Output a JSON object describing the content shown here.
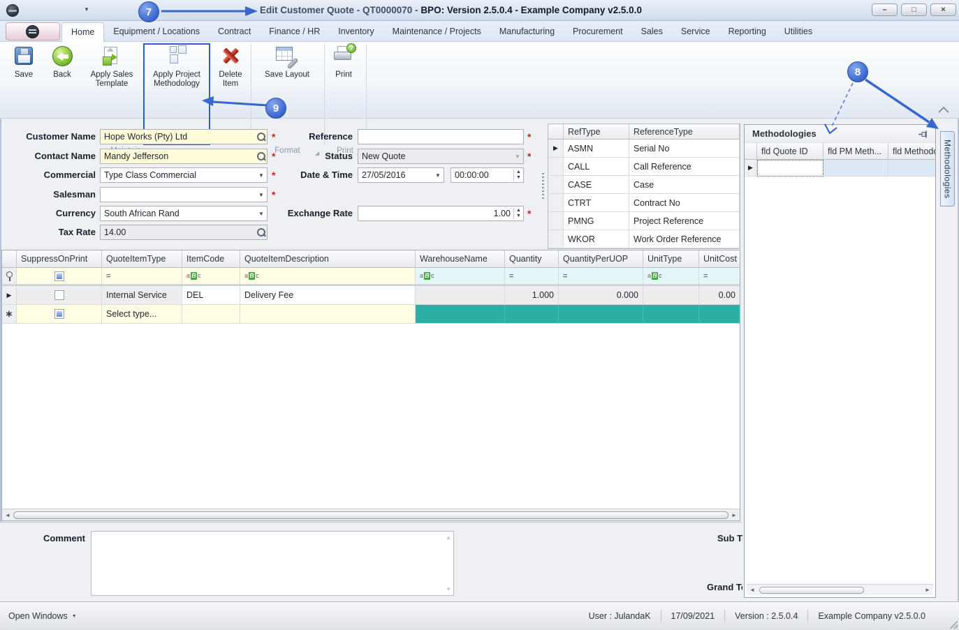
{
  "window": {
    "title_part1": "Edit Customer Quote - QT0000070 - ",
    "title_part2": "BPO: Version 2.5.0.4 - Example Company v2.5.0.0"
  },
  "tabs": [
    "Home",
    "Equipment / Locations",
    "Contract",
    "Finance / HR",
    "Inventory",
    "Maintenance / Projects",
    "Manufacturing",
    "Procurement",
    "Sales",
    "Service",
    "Reporting",
    "Utilities"
  ],
  "ribbon": {
    "buttons": {
      "save": "Save",
      "back": "Back",
      "apply_sales": "Apply Sales Template",
      "apply_pm": "Apply Project Methodology",
      "delete_item": "Delete Item",
      "save_layout": "Save Layout",
      "print": "Print"
    },
    "groups": {
      "maintain": "Maintain",
      "format": "Format",
      "print": "Print"
    }
  },
  "form": {
    "customer_name": {
      "label": "Customer Name",
      "value": "Hope Works (Pty) Ltd"
    },
    "contact_name": {
      "label": "Contact Name",
      "value": "Mandy Jefferson"
    },
    "commercial": {
      "label": "Commercial",
      "value": "Type Class Commercial"
    },
    "salesman": {
      "label": "Salesman",
      "value": ""
    },
    "currency": {
      "label": "Currency",
      "value": "South African Rand"
    },
    "tax_rate": {
      "label": "Tax Rate",
      "value": "14.00"
    },
    "reference": {
      "label": "Reference",
      "value": ""
    },
    "status": {
      "label": "Status",
      "value": "New Quote"
    },
    "date_time": {
      "label": "Date & Time",
      "date": "27/05/2016",
      "time": "00:00:00"
    },
    "exchange_rate": {
      "label": "Exchange Rate",
      "value": "1.00"
    }
  },
  "ref_grid": {
    "columns": [
      "RefType",
      "ReferenceType"
    ],
    "rows": [
      [
        "ASMN",
        "Serial No"
      ],
      [
        "CALL",
        "Call Reference"
      ],
      [
        "CASE",
        "Case"
      ],
      [
        "CTRT",
        "Contract No"
      ],
      [
        "PMNG",
        "Project Reference"
      ],
      [
        "WKOR",
        "Work Order Reference"
      ]
    ]
  },
  "methodologies": {
    "title": "Methodologies",
    "tab_label": "Methodologies",
    "columns": [
      "fld Quote ID",
      "fld PM Meth...",
      "fld Methodo"
    ]
  },
  "items_grid": {
    "columns": [
      "SuppressOnPrint",
      "QuoteItemType",
      "ItemCode",
      "QuoteItemDescription",
      "WarehouseName",
      "Quantity",
      "QuantityPerUOP",
      "UnitType",
      "UnitCost"
    ],
    "row1": {
      "type": "Internal Service",
      "code": "DEL",
      "desc": "Delivery Fee",
      "warehouse": "",
      "qty": "1.000",
      "qty_per_uop": "0.000",
      "unit_type": "",
      "unit_cost": "0.00"
    },
    "new_row_label": "Select type..."
  },
  "comment": {
    "label": "Comment",
    "value": ""
  },
  "totals": {
    "sub": "Sub Total",
    "grand": "Grand Total"
  },
  "statusbar": {
    "open_windows": "Open Windows",
    "user": "User : JulandaK",
    "date": "17/09/2021",
    "version": "Version : 2.5.0.4",
    "company": "Example Company v2.5.0.0"
  },
  "callouts": {
    "n7": "7",
    "n8": "8",
    "n9": "9"
  },
  "icons": {
    "dropdown": "▼",
    "spin_up": "▲",
    "spin_down": "▼",
    "required": "*",
    "row_arrow": "▶",
    "new_row_marker": "∗",
    "equals": "=",
    "abc_a": "a",
    "abc_b": "B",
    "abc_c": "c",
    "minimize": "–",
    "maximize": "□",
    "close": "×",
    "scroll_left": "◄",
    "scroll_right": "►",
    "scroll_up": "▲",
    "scroll_down": "▼",
    "qat_arrow": "▼",
    "print_badge": "?"
  }
}
